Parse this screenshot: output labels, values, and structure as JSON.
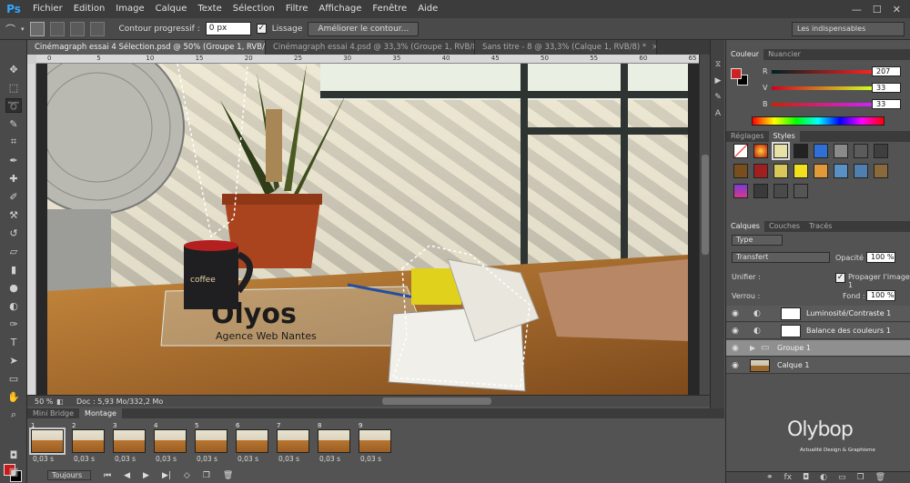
{
  "app": {
    "logo": "Ps"
  },
  "menu": [
    "Fichier",
    "Edition",
    "Image",
    "Calque",
    "Texte",
    "Sélection",
    "Filtre",
    "Affichage",
    "Fenêtre",
    "Aide"
  ],
  "window_controls": {
    "minimize": "—",
    "maximize": "☐",
    "close": "✕"
  },
  "options": {
    "feather_label": "Contour progressif :",
    "feather_value": "0 px",
    "antialias_label": "Lissage",
    "antialias_checked": true,
    "refine_button": "Améliorer le contour...",
    "workspace": "Les indispensables"
  },
  "tabs": [
    {
      "label": "Cinémagraph essai 4 Sélection.psd @ 50% (Groupe 1, RVB/8) *",
      "active": true
    },
    {
      "label": "Cinémagraph essai 4.psd @ 33,3% (Groupe 1, RVB/8) *",
      "active": false
    },
    {
      "label": "Sans titre - 8 @ 33,3% (Calque 1, RVB/8) *",
      "active": false
    }
  ],
  "ruler_ticks": [
    "0",
    "5",
    "10",
    "15",
    "20",
    "25",
    "30",
    "35",
    "40",
    "45",
    "50",
    "55",
    "60",
    "65"
  ],
  "canvas": {
    "brand_text": "Olyos",
    "brand_tagline": "Agence Web Nantes",
    "mug_text": "coffee"
  },
  "status": {
    "zoom": "50 %",
    "doc": "Doc : 5,93 Mo/332,2 Mo"
  },
  "timeline": {
    "tabs": [
      {
        "label": "Mini Bridge",
        "active": false
      },
      {
        "label": "Montage",
        "active": true
      }
    ],
    "frames": [
      {
        "num": "1",
        "delay": "0,03 s"
      },
      {
        "num": "2",
        "delay": "0,03 s"
      },
      {
        "num": "3",
        "delay": "0,03 s"
      },
      {
        "num": "4",
        "delay": "0,03 s"
      },
      {
        "num": "5",
        "delay": "0,03 s"
      },
      {
        "num": "6",
        "delay": "0,03 s"
      },
      {
        "num": "7",
        "delay": "0,03 s"
      },
      {
        "num": "8",
        "delay": "0,03 s"
      },
      {
        "num": "9",
        "delay": "0,03 s"
      }
    ],
    "loop": "Toujours"
  },
  "color_panel": {
    "tabs": [
      {
        "label": "Couleur",
        "active": true
      },
      {
        "label": "Nuancier",
        "active": false
      }
    ],
    "r_label": "R",
    "r": "207",
    "g_label": "V",
    "g": "33",
    "b_label": "B",
    "b": "33",
    "fg_color": "#cf2121"
  },
  "styles_panel": {
    "tabs": [
      {
        "label": "Réglages",
        "active": false
      },
      {
        "label": "Styles",
        "active": true
      }
    ]
  },
  "layers_panel": {
    "tabs": [
      {
        "label": "Calques",
        "active": true
      },
      {
        "label": "Couches",
        "active": false
      },
      {
        "label": "Tracés",
        "active": false
      }
    ],
    "filter": "Type",
    "blend_mode": "Transfert",
    "opacity_label": "Opacité :",
    "opacity": "100 %",
    "unify_label": "Unifier :",
    "propagate_label": "Propager l'image 1",
    "lock_label": "Verrou :",
    "fill_label": "Fond :",
    "fill": "100 %",
    "layers": [
      {
        "name": "Luminosité/Contraste 1",
        "selected": false
      },
      {
        "name": "Balance des couleurs 1",
        "selected": false
      },
      {
        "name": "Groupe 1",
        "selected": true
      },
      {
        "name": "Calque 1",
        "selected": false
      }
    ]
  },
  "watermark": {
    "name": "Olybop",
    "tagline": "Actualité Design & Graphisme"
  }
}
